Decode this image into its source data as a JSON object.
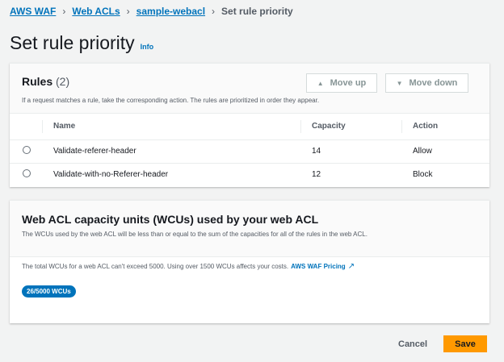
{
  "breadcrumb": [
    "AWS WAF",
    "Web ACLs",
    "sample-webacl",
    "Set rule priority"
  ],
  "page_title": "Set rule priority",
  "info_link": "Info",
  "rules": {
    "title": "Rules",
    "count": "(2)",
    "description": "If a request matches a rule, take the corresponding action. The rules are prioritized in order they appear.",
    "move_up": "Move up",
    "move_down": "Move down",
    "columns": [
      "Name",
      "Capacity",
      "Action"
    ],
    "rows": [
      {
        "name": "Validate-referer-header",
        "capacity": "14",
        "action": "Allow"
      },
      {
        "name": "Validate-with-no-Referer-header",
        "capacity": "12",
        "action": "Block"
      }
    ]
  },
  "wcu": {
    "title": "Web ACL capacity units (WCUs) used by your web ACL",
    "description": "The WCUs used by the web ACL will be less than or equal to the sum of the capacities for all of the rules in the web ACL.",
    "note": "The total WCUs for a web ACL can't exceed 5000. Using over 1500 WCUs affects your costs.",
    "pricing_link": "AWS WAF Pricing",
    "badge": "26/5000 WCUs"
  },
  "footer": {
    "cancel": "Cancel",
    "save": "Save"
  }
}
